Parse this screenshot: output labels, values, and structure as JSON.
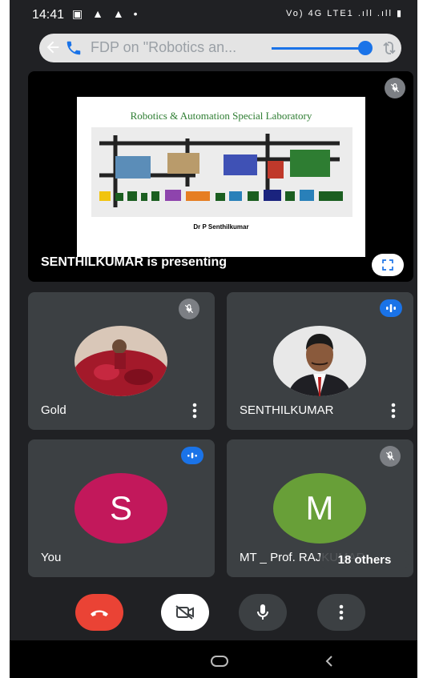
{
  "status_bar": {
    "time": "14:41",
    "left_icons": "▣ ▲ ▲ •",
    "right_icons": "Vo) 4G LTE1 .ıll .ıll ▮"
  },
  "meeting_bar": {
    "title": "FDP on \"Robotics an...",
    "chevron": "›"
  },
  "presentation": {
    "slide_title": "Robotics & Automation Special Laboratory",
    "slide_author": "Dr P Senthilkumar",
    "presenting_label": "SENTHILKUMAR is presenting"
  },
  "participants": [
    {
      "name": "Gold",
      "avatar": "photo",
      "audio": "muted"
    },
    {
      "name": "SENTHILKUMAR",
      "avatar": "photo",
      "audio": "speaking"
    },
    {
      "name": "You",
      "avatar_letter": "S",
      "avatar_color": "#c2185b",
      "audio": "speaking"
    },
    {
      "name": "MT _ Prof. RAJKUMAR",
      "avatar_letter": "M",
      "avatar_color": "#689f38",
      "audio": "muted",
      "others_badge": "18 others"
    }
  ],
  "controls": {
    "end_call_color": "#ea4335",
    "camera_state": "off",
    "mic_state": "on"
  },
  "colors": {
    "background": "#202124",
    "tile": "#3c4043",
    "accent_blue": "#1a73e8"
  }
}
